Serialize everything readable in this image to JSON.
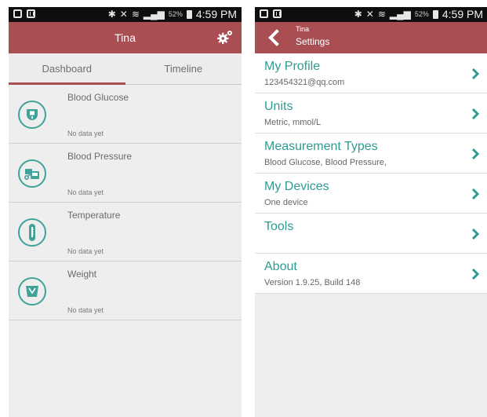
{
  "status_bar": {
    "battery": "52%",
    "time": "4:59 PM"
  },
  "dashboard": {
    "title": "Tina",
    "tabs": [
      {
        "label": "Dashboard"
      },
      {
        "label": "Timeline"
      }
    ],
    "items": [
      {
        "name": "Blood Glucose",
        "status": "No data yet",
        "icon": "blood-glucose-icon"
      },
      {
        "name": "Blood Pressure",
        "status": "No data yet",
        "icon": "blood-pressure-icon"
      },
      {
        "name": "Temperature",
        "status": "No data yet",
        "icon": "thermometer-icon"
      },
      {
        "name": "Weight",
        "status": "No data yet",
        "icon": "scale-icon"
      }
    ]
  },
  "settings": {
    "owner": "Tina",
    "title": "Settings",
    "items": [
      {
        "label": "My Profile",
        "sub": "123454321@qq.com"
      },
      {
        "label": "Units",
        "sub": "Metric, mmol/L"
      },
      {
        "label": "Measurement Types",
        "sub": "Blood Glucose, Blood Pressure,"
      },
      {
        "label": "My Devices",
        "sub": "One device"
      },
      {
        "label": "Tools",
        "sub": ""
      },
      {
        "label": "About",
        "sub": "Version 1.9.25, Build 148"
      }
    ]
  },
  "colors": {
    "app_bar": "#a94f54",
    "accent_teal": "#2e9b92",
    "status_bar": "#0f0f0f"
  }
}
